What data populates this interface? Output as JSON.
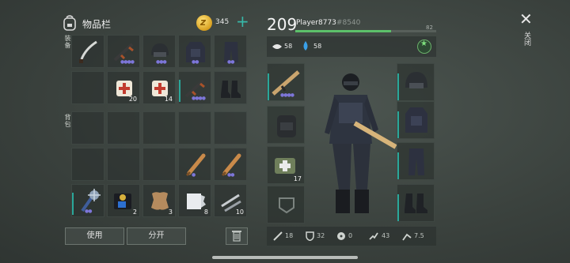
{
  "inventory": {
    "title": "物品栏",
    "coins": "345",
    "side_label_top": "装备",
    "side_label_bottom": "背包",
    "slots": [
      {
        "icon": "machete-icon",
        "count": ""
      },
      {
        "icon": "assault-rifle-icon",
        "count": "",
        "rarity": "●●●●"
      },
      {
        "icon": "helmet-icon",
        "count": "",
        "rarity": "●●●"
      },
      {
        "icon": "armor-vest-icon",
        "count": "",
        "rarity": "●●"
      },
      {
        "icon": "pants-icon",
        "count": "",
        "rarity": "●●"
      },
      {
        "icon": "empty-slot",
        "count": ""
      },
      {
        "icon": "bandage-icon",
        "count": "20"
      },
      {
        "icon": "bandage-icon",
        "count": "14"
      },
      {
        "icon": "assault-rifle-icon",
        "count": "",
        "rarity": "●●●●"
      },
      {
        "icon": "boots-icon",
        "count": ""
      },
      {
        "icon": "baseball-bat-icon",
        "count": "",
        "rarity": "●"
      },
      {
        "icon": "baseball-bat-icon",
        "count": "",
        "rarity": "●●"
      },
      {
        "icon": "spiked-club-icon",
        "count": "",
        "rarity": "●●"
      },
      {
        "icon": "police-badge-icon",
        "count": "2"
      },
      {
        "icon": "leather-icon",
        "count": "3"
      },
      {
        "icon": "duct-tape-icon",
        "count": "8"
      },
      {
        "icon": "tools-icon",
        "count": "10"
      }
    ]
  },
  "buttons": {
    "use": "使用",
    "split": "分开"
  },
  "player": {
    "level": "209",
    "name": "Player8773",
    "id": "#8540",
    "xp_value": "82",
    "xp_fraction": 0.68,
    "food": "58",
    "water": "58"
  },
  "equipment": {
    "left": [
      {
        "icon": "scar-rifle-icon",
        "count": "",
        "rarity": "●●●●"
      },
      {
        "icon": "backpack-icon",
        "count": ""
      },
      {
        "icon": "medkit-icon",
        "count": "17"
      },
      {
        "icon": "empty-pocket-icon",
        "count": ""
      }
    ],
    "right": [
      {
        "icon": "helmet-icon"
      },
      {
        "icon": "armor-vest-icon"
      },
      {
        "icon": "pants-icon"
      },
      {
        "icon": "boots-icon"
      }
    ]
  },
  "bottom_stats": {
    "attack": "18",
    "defense": "32",
    "radiation": "0",
    "speed": "43",
    "stealth": "7.5"
  },
  "close_label": "关闭",
  "colors": {
    "accent": "#2aa79a",
    "rarity": "#7d76d9",
    "xp": "#5cc06a",
    "coin": "#d8a020"
  }
}
